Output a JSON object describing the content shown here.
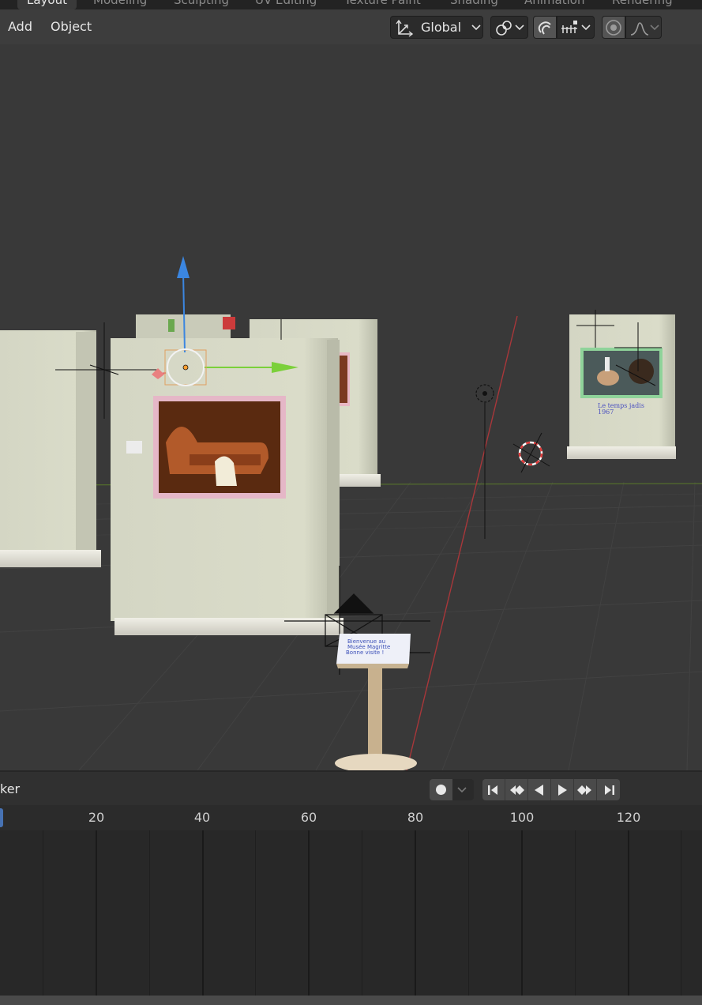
{
  "workspace_tabs": [
    "Layout",
    "Modeling",
    "Sculpting",
    "UV Editing",
    "Texture Paint",
    "Shading",
    "Animation",
    "Rendering"
  ],
  "header": {
    "menu": [
      "Add",
      "Object"
    ],
    "transform_orientation": "Global"
  },
  "scene": {
    "label_artwork_right": "Le temps jadis",
    "label_artwork_right_year": "1967",
    "lectern_text_1": "Bienvenue au",
    "lectern_text_2": "Musée Magritte",
    "lectern_text_3": "Bonne visite !"
  },
  "timeline": {
    "editor_label": "ker",
    "frame_ticks": [
      "20",
      "40",
      "60",
      "80",
      "100",
      "120"
    ]
  },
  "colors": {
    "accent_blue": "#4772b3",
    "axis_x": "#d93b3b",
    "axis_y": "#7bd03a",
    "gizmo_z": "#3b86e0"
  },
  "icons": {
    "orientation": "transform-orientation-icon",
    "pivot": "pivot-point-icon",
    "snap": "snap-magnet-icon",
    "increment": "snap-increment-icon",
    "proportional": "proportional-editing-icon",
    "falloff": "falloff-curve-icon",
    "record": "record-icon"
  }
}
